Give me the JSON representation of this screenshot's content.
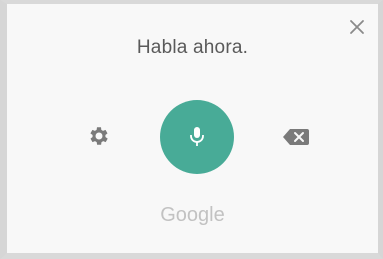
{
  "dialog": {
    "prompt": "Habla ahora.",
    "brand": "Google",
    "icons": {
      "close": "close-icon",
      "settings": "gear-icon",
      "microphone": "microphone-icon",
      "backspace": "backspace-icon"
    },
    "colors": {
      "mic_button": "#48ab97",
      "icon_gray": "#7a7a7a",
      "prompt_text": "#5a5a5a",
      "brand_text": "#c2c2c2"
    }
  }
}
